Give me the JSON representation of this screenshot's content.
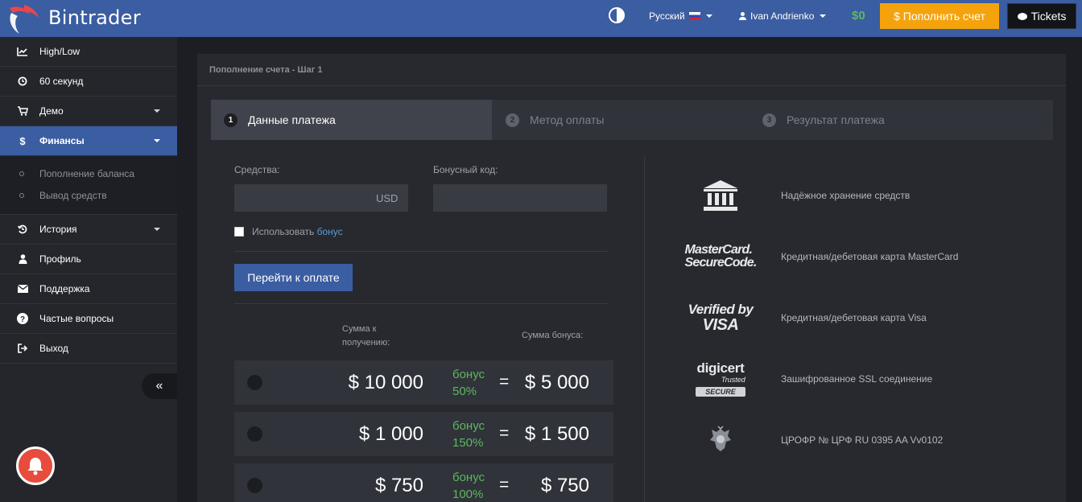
{
  "header": {
    "brand": "Bintrader",
    "language": "Русский",
    "user_name": "Ivan Andrienko",
    "balance": "$0",
    "deposit_button": "$ Пополнить счет",
    "tickets_button": "Tickets",
    "colors": {
      "bar": "#3b5da1",
      "deposit": "#f5a30d",
      "balance": "#5cb85c"
    }
  },
  "sidebar": {
    "items": [
      {
        "label": "High/Low",
        "icon": "line-chart-icon"
      },
      {
        "label": "60 секунд",
        "icon": "clock-icon"
      },
      {
        "label": "Демо",
        "icon": "cart-icon"
      },
      {
        "label": "Финансы",
        "icon": "dollar-icon"
      },
      {
        "label": "История",
        "icon": "history-icon"
      },
      {
        "label": "Профиль",
        "icon": "user-icon"
      },
      {
        "label": "Поддержка",
        "icon": "envelope-icon"
      },
      {
        "label": "Частые вопросы",
        "icon": "question-icon"
      },
      {
        "label": "Выход",
        "icon": "sign-out-icon"
      }
    ],
    "finance_sub": [
      {
        "label": "Пополнение баланса"
      },
      {
        "label": "Вывод средств"
      }
    ],
    "collapse_symbol": "«"
  },
  "panel": {
    "title": "Пополнение счета - Шаг 1",
    "steps": [
      {
        "num": "1",
        "label": "Данные платежа"
      },
      {
        "num": "2",
        "label": "Метод оплаты"
      },
      {
        "num": "3",
        "label": "Результат платежа"
      }
    ],
    "form": {
      "funds_label": "Средства:",
      "funds_value": "",
      "currency": "USD",
      "bonus_code_label": "Бонусный код:",
      "bonus_code_value": "",
      "use_bonus_text": "Использовать",
      "use_bonus_link": "бонус",
      "submit": "Перейти к оплате"
    },
    "table": {
      "col_receive": "Сумма к получению:",
      "col_bonus": "Сумма бонуса:",
      "offers": [
        {
          "amount": "$ 10 000",
          "bonus_word": "бонус",
          "bonus_pct": "50%",
          "eq": "=",
          "bonus_amount": "$ 5 000"
        },
        {
          "amount": "$ 1 000",
          "bonus_word": "бонус",
          "bonus_pct": "150%",
          "eq": "=",
          "bonus_amount": "$ 1 500"
        },
        {
          "amount": "$ 750",
          "bonus_word": "бонус",
          "bonus_pct": "100%",
          "eq": "=",
          "bonus_amount": "$ 750"
        }
      ]
    },
    "trust": [
      {
        "logo": "bank-icon",
        "text": "Надёжное хранение средств"
      },
      {
        "logo": "mastercard-securecode-logo",
        "logo_text": [
          "MasterCard.",
          "SecureCode."
        ],
        "text": "Кредитная/дебетовая карта MasterCard"
      },
      {
        "logo": "verified-by-visa-logo",
        "logo_text": [
          "Verified by",
          "VISA"
        ],
        "text": "Кредитная/дебетовая карта Visa"
      },
      {
        "logo": "digicert-logo",
        "logo_text": [
          "digicert",
          "Trusted",
          "SECURE"
        ],
        "text": "Зашифрованное SSL соединение"
      },
      {
        "logo": "cbrf-emblem",
        "text": "ЦРОФР № ЦРФ RU 0395 AA Vv0102"
      }
    ]
  }
}
